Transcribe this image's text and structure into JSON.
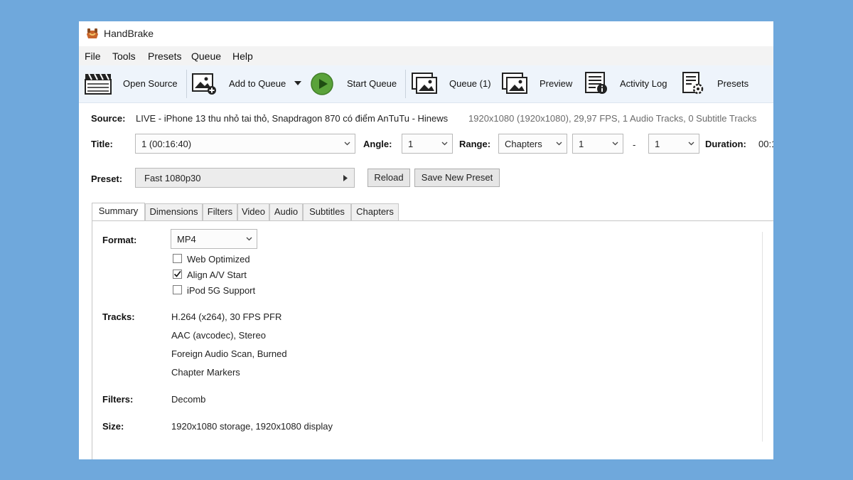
{
  "window": {
    "title": "HandBrake"
  },
  "menu": [
    "File",
    "Tools",
    "Presets",
    "Queue",
    "Help"
  ],
  "toolbar": {
    "open_source": "Open Source",
    "add_to_queue": "Add to Queue",
    "start_queue": "Start Queue",
    "queue": "Queue (1)",
    "preview": "Preview",
    "activity_log": "Activity Log",
    "presets": "Presets"
  },
  "source": {
    "label": "Source:",
    "name": "LIVE - iPhone 13 thu nhỏ tai thỏ, Snapdragon 870 có điểm AnTuTu - Hinews",
    "info": "1920x1080 (1920x1080), 29,97 FPS, 1 Audio Tracks, 0 Subtitle Tracks"
  },
  "title_row": {
    "title_label": "Title:",
    "title_value": "1 (00:16:40)",
    "angle_label": "Angle:",
    "angle_value": "1",
    "range_label": "Range:",
    "range_value": "Chapters",
    "range_start": "1",
    "range_sep": "-",
    "range_end": "1",
    "duration_label": "Duration:",
    "duration_value": "00:1"
  },
  "preset": {
    "label": "Preset:",
    "value": "Fast 1080p30",
    "reload": "Reload",
    "save_new": "Save New Preset"
  },
  "tabs": [
    "Summary",
    "Dimensions",
    "Filters",
    "Video",
    "Audio",
    "Subtitles",
    "Chapters"
  ],
  "summary": {
    "format_label": "Format:",
    "format_value": "MP4",
    "options": [
      {
        "label": "Web Optimized",
        "checked": false
      },
      {
        "label": "Align A/V Start",
        "checked": true
      },
      {
        "label": "iPod 5G Support",
        "checked": false
      }
    ],
    "tracks_label": "Tracks:",
    "tracks": [
      "H.264 (x264), 30 FPS PFR",
      "AAC (avcodec), Stereo",
      "Foreign Audio Scan, Burned",
      "Chapter Markers"
    ],
    "filters_label": "Filters:",
    "filters_value": "Decomb",
    "size_label": "Size:",
    "size_value": "1920x1080 storage, 1920x1080 display"
  }
}
